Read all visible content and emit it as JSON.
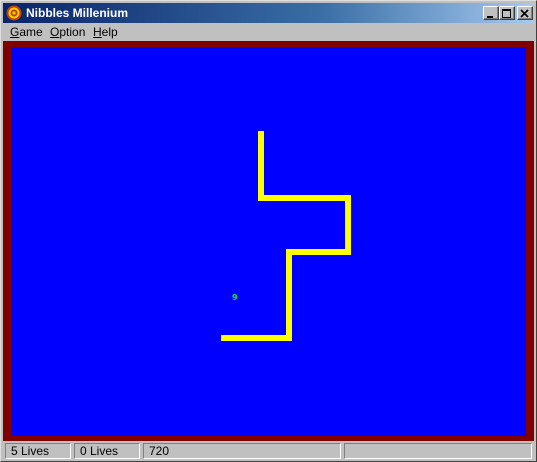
{
  "window": {
    "title": "Nibbles Millenium",
    "icon": "target-icon",
    "controls": [
      "minimize-icon",
      "maximize-icon",
      "close-icon"
    ]
  },
  "menu": {
    "items": [
      {
        "label": "Game",
        "mnemonic": "G"
      },
      {
        "label": "Option",
        "mnemonic": "O"
      },
      {
        "label": "Help",
        "mnemonic": "H"
      }
    ]
  },
  "board": {
    "background_color": "#0000ff",
    "border_color": "#800000",
    "snake_color": "#ffff00",
    "food": {
      "value": "9",
      "color": "#00ff00"
    }
  },
  "status": {
    "player1_lives": "5 Lives",
    "player2_lives": "0 Lives",
    "score": "720",
    "empty": ""
  }
}
